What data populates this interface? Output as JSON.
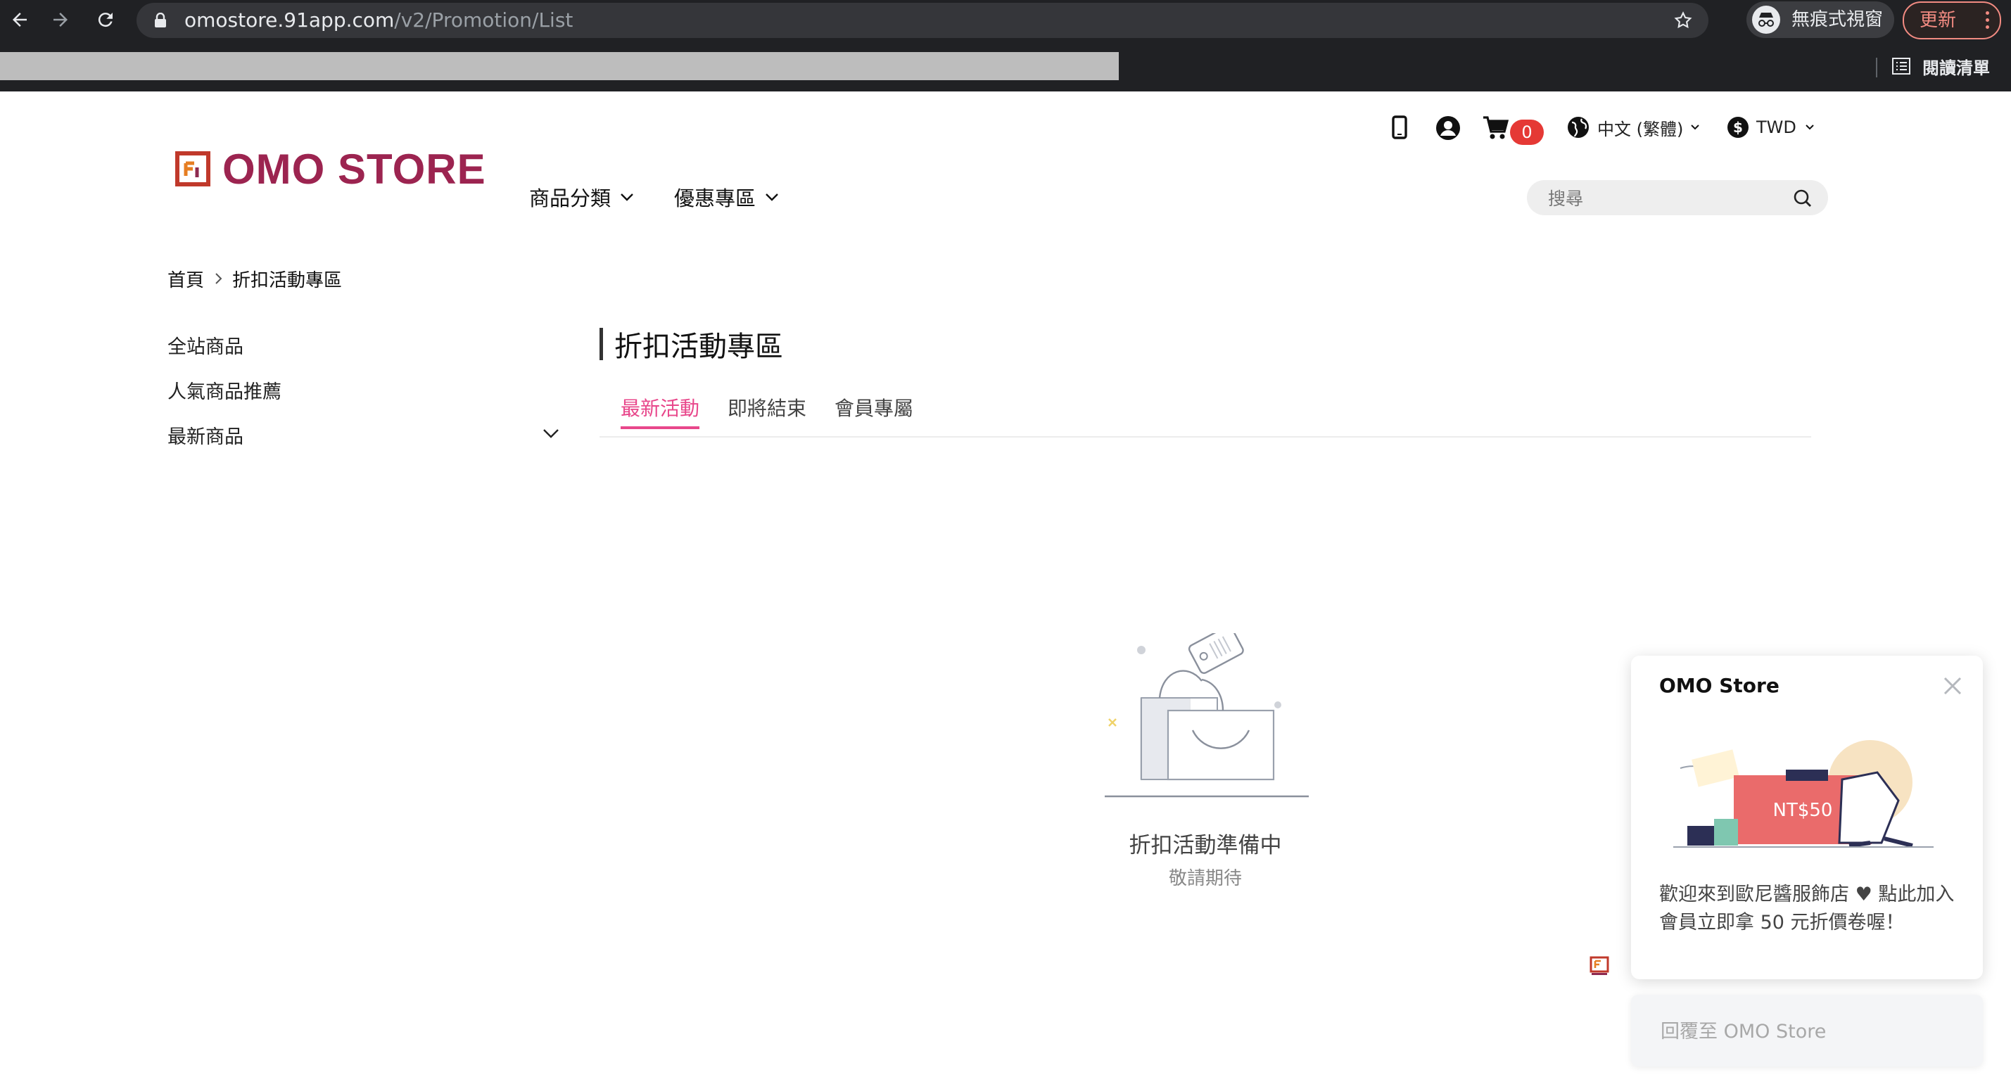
{
  "browser": {
    "url_host": "omostore.91app.com",
    "url_path": "/v2/Promotion/List",
    "incognito_label": "無痕式視窗",
    "update_label": "更新",
    "reading_list_label": "閱讀清單"
  },
  "header": {
    "logo_text": "OMO STORE",
    "cart_count": "0",
    "language": "中文 (繁體)",
    "currency": "TWD",
    "search_placeholder": "搜尋",
    "menu": [
      {
        "label": "商品分類"
      },
      {
        "label": "優惠專區"
      }
    ]
  },
  "breadcrumb": {
    "home": "首頁",
    "current": "折扣活動專區"
  },
  "sidebar": {
    "items": [
      {
        "label": "全站商品"
      },
      {
        "label": "人氣商品推薦"
      },
      {
        "label": "最新商品"
      }
    ]
  },
  "main": {
    "title": "折扣活動專區",
    "tabs": [
      {
        "label": "最新活動"
      },
      {
        "label": "即將結束"
      },
      {
        "label": "會員專屬"
      }
    ],
    "empty_title": "折扣活動準備中",
    "empty_subtitle": "敬請期待"
  },
  "chat": {
    "title": "OMO Store",
    "coupon_text": "NT$50",
    "message": "歡迎來到歐尼醬服飾店 ♥ 點此加入會員立即拿 50 元折價卷喔！",
    "reply_placeholder": "回覆至 OMO Store"
  },
  "colors": {
    "accent": "#e8478b",
    "brand": "#9c2450",
    "badge": "#e53935",
    "chrome_bg": "#202124"
  }
}
